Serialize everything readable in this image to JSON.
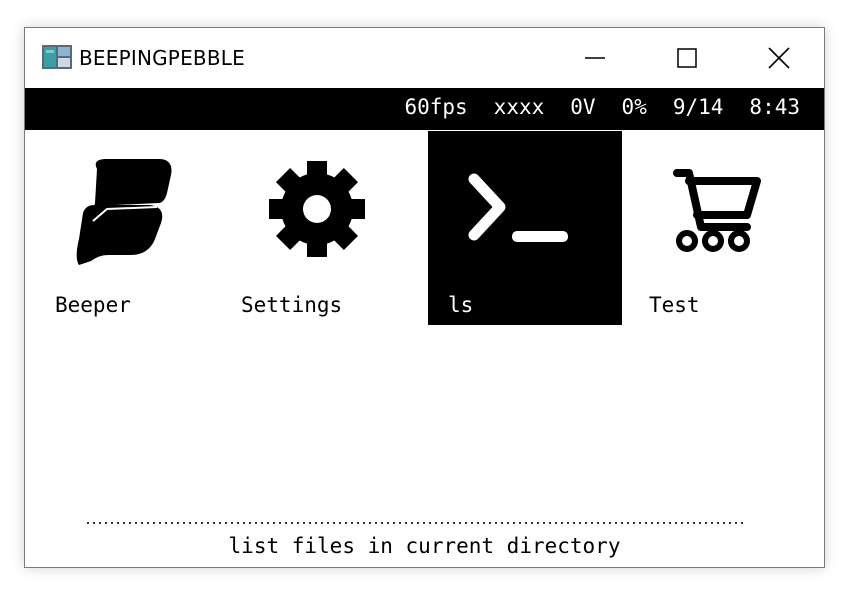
{
  "window": {
    "title": "BEEPINGPEBBLE",
    "controls": {
      "minimize": "minimize",
      "maximize": "maximize",
      "close": "close"
    }
  },
  "status": {
    "fps": "60fps",
    "field2": "xxxx",
    "voltage": "0V",
    "battery": "0%",
    "date": "9/14",
    "time": "8:43"
  },
  "apps": [
    {
      "label": "Beeper",
      "icon": "beeper-logo-icon",
      "selected": false
    },
    {
      "label": "Settings",
      "icon": "gear-icon",
      "selected": false
    },
    {
      "label": "ls",
      "icon": "terminal-icon",
      "selected": true
    },
    {
      "label": "Test",
      "icon": "shopping-cart-icon",
      "selected": false
    }
  ],
  "description": "list files in current directory",
  "colors": {
    "background": "#ffffff",
    "statusbar": "#000000",
    "selected_tile": "#000000"
  }
}
